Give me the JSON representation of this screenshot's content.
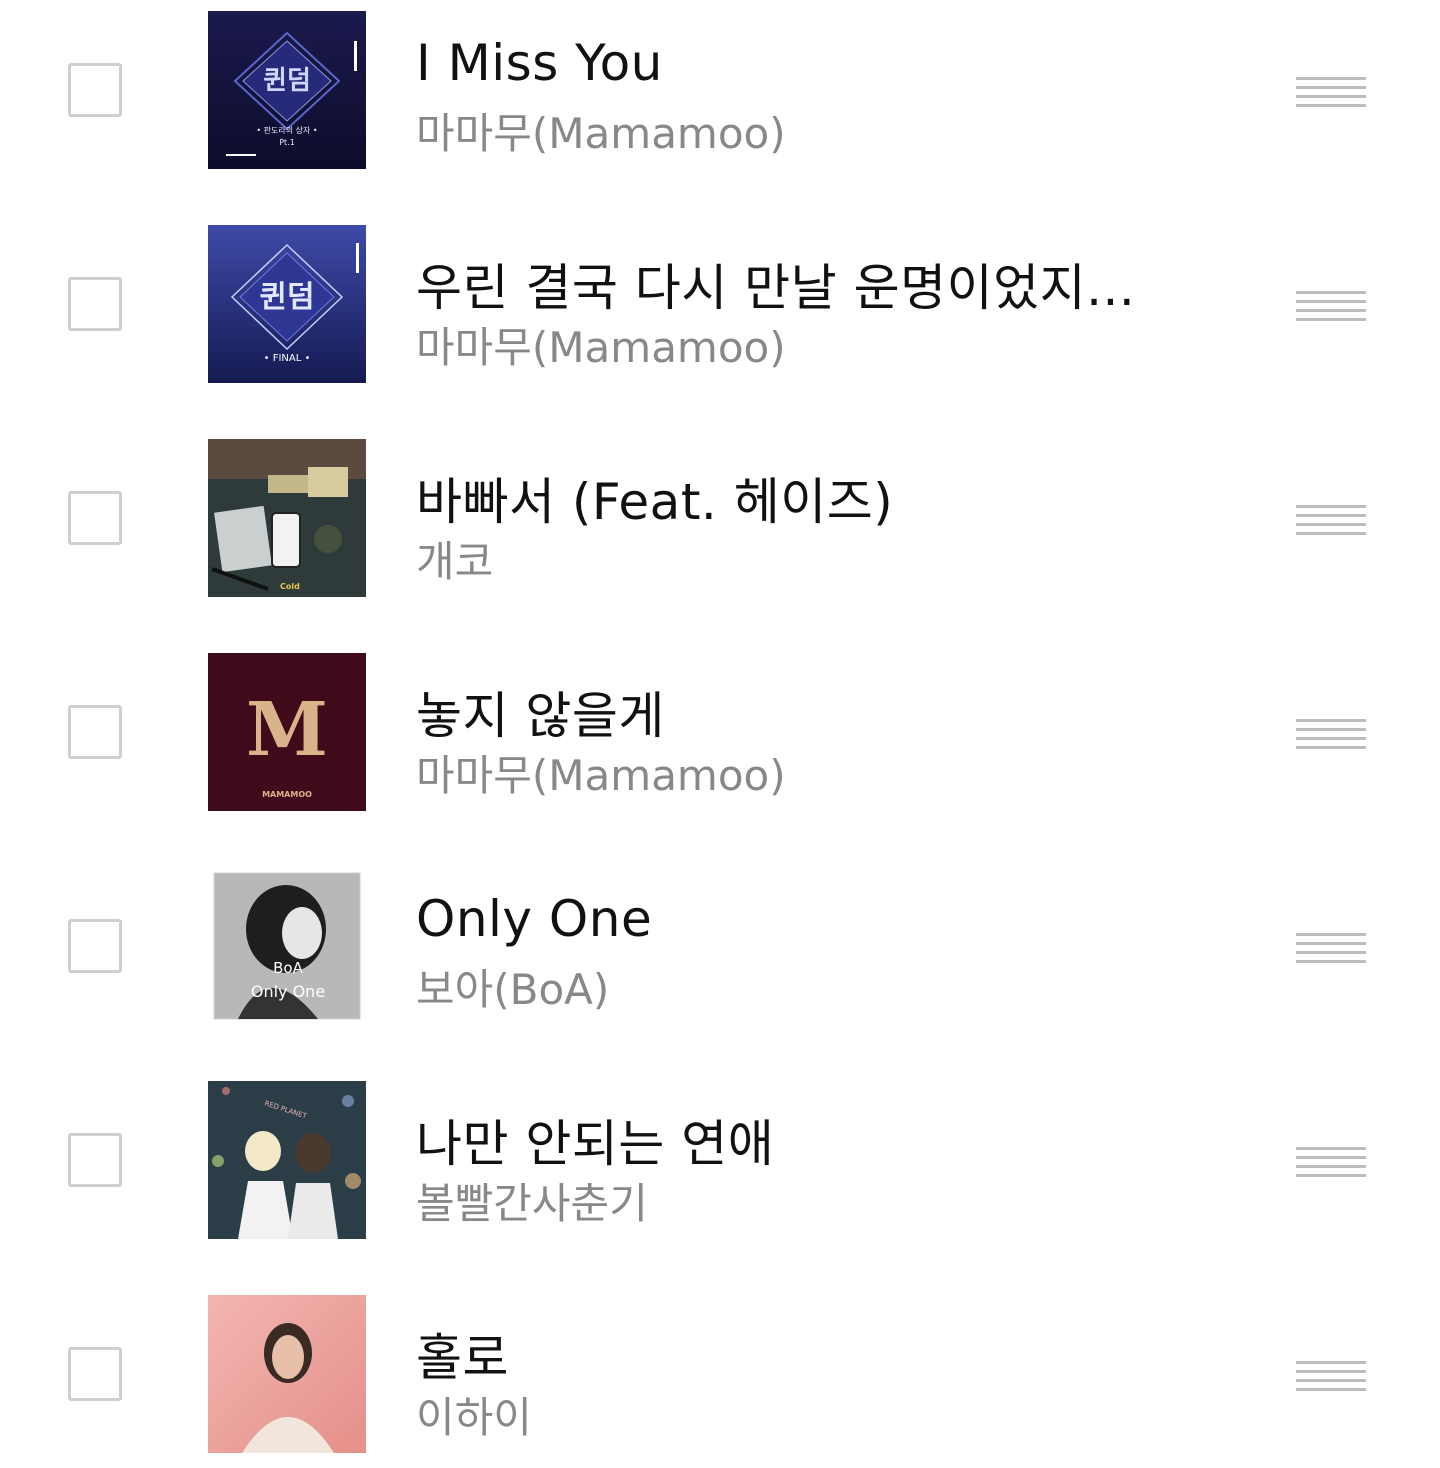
{
  "tracks": [
    {
      "title": "I Miss You",
      "artist": "마마무(Mamamoo)",
      "art_icon": "album-cover-queendom-pt1"
    },
    {
      "title": "우린 결국 다시 만날 운명이었지...",
      "artist": "마마무(Mamamoo)",
      "art_icon": "album-cover-queendom-final"
    },
    {
      "title": "바빠서 (Feat. 헤이즈)",
      "artist": "개코",
      "art_icon": "album-cover-desk-cold"
    },
    {
      "title": "놓지 않을게",
      "artist": "마마무(Mamamoo)",
      "art_icon": "album-cover-mamamoo-m"
    },
    {
      "title": "Only One",
      "artist": "보아(BoA)",
      "art_icon": "album-cover-boa-only-one"
    },
    {
      "title": "나만 안되는 연애",
      "artist": "볼빨간사춘기",
      "art_icon": "album-cover-red-planet"
    },
    {
      "title": "홀로",
      "artist": "이하이",
      "art_icon": "album-cover-pink-portrait"
    }
  ],
  "art_text": {
    "queendom": "퀸덤",
    "queendom_sub": "• 판도라의 상자 •",
    "pt1": "Pt.1",
    "final": "• FINAL •",
    "cold": "Cold",
    "m_letter": "M",
    "mamamoo_logo": "MAMAMOO",
    "boa_name": "BoA",
    "boa_title": "Only One",
    "red_planet": "RED PLANET"
  },
  "colors": {
    "title": "#111111",
    "artist": "#888888",
    "checkbox_border": "#cfcfcf",
    "handle": "#bdbdbd"
  }
}
